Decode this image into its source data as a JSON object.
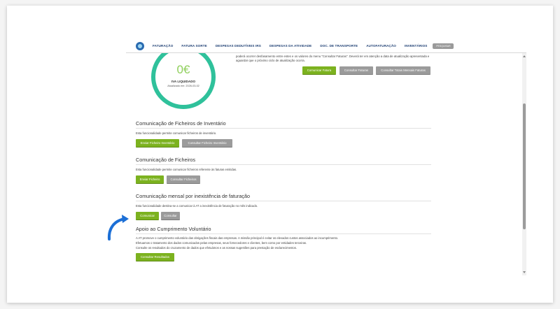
{
  "nav": {
    "items": [
      "FATURAÇÃO",
      "FATURA SORTE",
      "DESPESAS DEDUTÍVEIS IRS",
      "DESPESAS DA ATIVIDADE",
      "DOC. DE TRANSPORTE",
      "AUTOFATURAÇÃO",
      "INVENTÁRIOS"
    ],
    "search_label": "PESQUISAR"
  },
  "iva": {
    "value": "0€",
    "label": "IVA LIQUIDADO",
    "updated": "Atualizado em: 2026-03-02"
  },
  "intro": {
    "text": "poderá ocorrer desfasamento entre estes e os valores do menu \"Consultar Faturas\". Deverá ter em atenção a data de atualização apresentada e aguardar que o próximo ciclo de atualização ocorra.",
    "buttons": [
      "Comunicar Fatura",
      "Consultar Faturas",
      "Consultar Totais Mensais Faturas"
    ]
  },
  "sections": {
    "inventario": {
      "title": "Comunicação de Ficheiros de Inventário",
      "desc": "Esta funcionalidade permite comunicar ficheiros de inventário.",
      "buttons": [
        "Enviar Ficheiro Inventário",
        "Consultar Ficheiro Inventário"
      ]
    },
    "ficheiros": {
      "title": "Comunicação de Ficheiros",
      "desc": "Esta funcionalidade permite comunicar ficheiros referente às faturas emitidas.",
      "buttons": [
        "Enviar Ficheiro",
        "Consultar Ficheiros"
      ]
    },
    "inexistencia": {
      "title": "Comunicação mensal por inexistência de faturação",
      "desc": "Esta funcionalidade destina-se a comunicar à AT a inexistência de faturação no mês indicado.",
      "buttons": [
        "Comunicar",
        "Consultar"
      ]
    },
    "apoio": {
      "title": "Apoio ao Cumprimento Voluntário",
      "desc": [
        "A AT promove o cumprimento voluntário das obrigações fiscais das empresas. A missão principal é evitar os elevados custos associados ao incumprimento.",
        "Efetuamos o tratamento dos dados comunicados pelas empresas, seus fornecedores e clientes, bem como por entidades terceiras.",
        "Consulte os resultados do cruzamento de dados que efetuámos e as nossas sugestões para prestação de esclarecimentos."
      ],
      "buttons": [
        "Consultar Resultados"
      ]
    }
  },
  "colors": {
    "accent_green": "#7cb21f",
    "ring_teal": "#2fc19b",
    "grey_button": "#9b9b9b",
    "annotation_arrow": "#1c6fd6"
  },
  "icons": [
    "at-logo-icon",
    "scroll-up-icon",
    "scroll-down-icon",
    "curved-arrow-icon"
  ]
}
